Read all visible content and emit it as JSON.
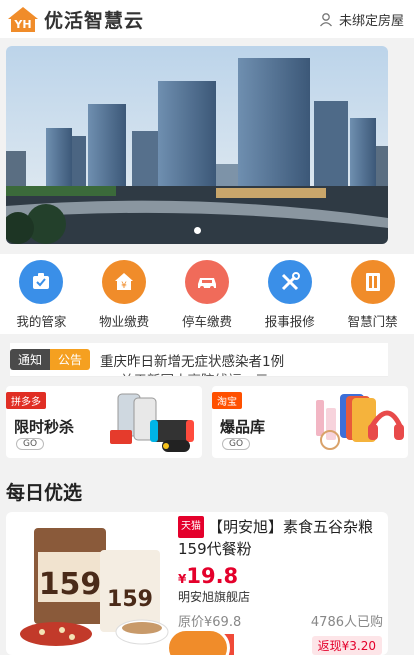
{
  "header": {
    "app_title": "优活智慧云",
    "bind_label": "未绑定房屋"
  },
  "services": [
    {
      "label": "我的管家",
      "icon": "butler-icon",
      "color": "#3a8fe8"
    },
    {
      "label": "物业缴费",
      "icon": "home-yuan-icon",
      "color": "#f08c2a"
    },
    {
      "label": "停车缴费",
      "icon": "car-icon",
      "color": "#f06b5a"
    },
    {
      "label": "报事报修",
      "icon": "tools-icon",
      "color": "#3a8fe8"
    },
    {
      "label": "智慧门禁",
      "icon": "door-icon",
      "color": "#f08c2a"
    }
  ],
  "ticker": {
    "tag_notice": "通知",
    "tag_ad": "公告",
    "line1": "重庆昨日新增无症状感染者1例",
    "line2": "关于新冠小高院线福…元"
  },
  "promos": [
    {
      "badge": "拼多多",
      "badge_color": "#e02e24",
      "title": "限时秒杀",
      "go": "GO"
    },
    {
      "badge": "淘宝",
      "badge_color": "#ff5000",
      "title": "爆品库",
      "go": "GO"
    }
  ],
  "daily": {
    "title": "每日优选",
    "product": {
      "badge": "天猫",
      "name": "【明安旭】素食五谷杂粮159代餐粉",
      "currency": "¥",
      "price": "19.8",
      "shop": "明安旭旗舰店",
      "original_price": "原价¥69.8",
      "sold": "4786人已购",
      "cashback": "返现¥3.20",
      "package_text": "159"
    }
  }
}
